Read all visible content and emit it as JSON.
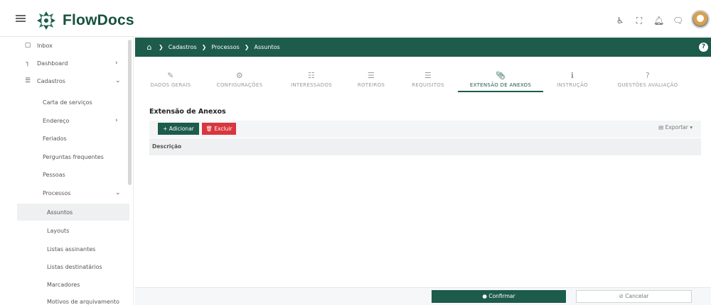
{
  "app": {
    "name": "FlowDocs"
  },
  "colors": {
    "brand": "#1d5b4b",
    "danger": "#d9363e"
  },
  "header": {
    "icons": [
      "accessibility-icon",
      "fullscreen-icon",
      "bell-icon",
      "chat-icon"
    ]
  },
  "sidebar": {
    "items": [
      {
        "label": "Inbox",
        "icon": "inbox-icon"
      },
      {
        "label": "Dashboard",
        "icon": "chart-icon",
        "chevron": ">"
      },
      {
        "label": "Cadastros",
        "icon": "list-icon",
        "chevron": "v"
      },
      {
        "label": "Carta de serviços"
      },
      {
        "label": "Endereço",
        "chevron": ">"
      },
      {
        "label": "Feriados"
      },
      {
        "label": "Perguntas frequentes"
      },
      {
        "label": "Pessoas"
      },
      {
        "label": "Processos",
        "chevron": "v"
      },
      {
        "label": "Assuntos",
        "active": true
      },
      {
        "label": "Layouts"
      },
      {
        "label": "Listas assinantes"
      },
      {
        "label": "Listas destinatários"
      },
      {
        "label": "Marcadores"
      },
      {
        "label": "Motivos de arquivamento"
      }
    ]
  },
  "breadcrumb": [
    "Cadastros",
    "Processos",
    "Assuntos"
  ],
  "tabs": [
    {
      "label": "DADOS GERAIS",
      "icon": "edit-icon"
    },
    {
      "label": "CONFIGURAÇÕES",
      "icon": "gears-icon"
    },
    {
      "label": "INTERESSADOS",
      "icon": "users-icon"
    },
    {
      "label": "ROTEIROS",
      "icon": "list-icon"
    },
    {
      "label": "REQUISITOS",
      "icon": "checklist-icon"
    },
    {
      "label": "EXTENSÃO DE ANEXOS",
      "icon": "paperclip-icon",
      "active": true
    },
    {
      "label": "INSTRUÇÃO",
      "icon": "info-icon"
    },
    {
      "label": "QUESTÕES AVALIAÇÃO",
      "icon": "question-icon"
    }
  ],
  "section": {
    "title": "Extensão de Anexos",
    "add_label": "Adicionar",
    "delete_label": "Excluir",
    "export_label": "Exportar",
    "column_description": "Descrição"
  },
  "footer": {
    "confirm_label": "Confirmar",
    "cancel_label": "Cancelar"
  }
}
